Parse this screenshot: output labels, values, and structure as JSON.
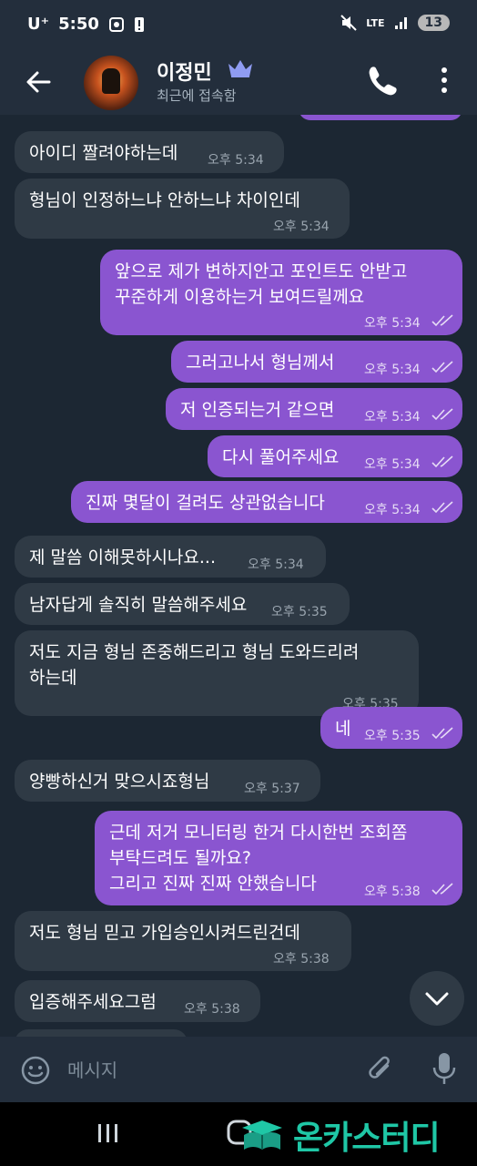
{
  "status_bar": {
    "carrier": "U⁺",
    "time": "5:50",
    "network": "LTE",
    "battery": "13"
  },
  "header": {
    "name": "이정민",
    "status": "최근에 접속함"
  },
  "messages": [
    {
      "dir": "in",
      "text": "아이디 짤려야하는데",
      "time": "오후 5:34"
    },
    {
      "dir": "in",
      "text": "형님이 인정하느냐 안하느냐 차이인데",
      "time": "오후 5:34"
    },
    {
      "dir": "out",
      "lines": [
        "앞으로 제가 변하지안고 포인트도 안받고",
        "꾸준하게 이용하는거 보여드릴께요"
      ],
      "time": "오후 5:34"
    },
    {
      "dir": "out",
      "text": "그러고나서 형님께서",
      "time": "오후 5:34"
    },
    {
      "dir": "out",
      "text": "저 인증되는거 같으면",
      "time": "오후 5:34"
    },
    {
      "dir": "out",
      "text": "다시 풀어주세요",
      "time": "오후 5:34"
    },
    {
      "dir": "out",
      "text": "진짜 몇달이 걸려도 상관없습니다",
      "time": "오후 5:34"
    },
    {
      "dir": "in",
      "text": "제 말씀 이해못하시나요...",
      "time": "오후 5:34"
    },
    {
      "dir": "in",
      "text": "남자답게 솔직히 말씀해주세요",
      "time": "오후 5:35"
    },
    {
      "dir": "in",
      "lines": [
        "저도 지금 형님 존중해드리고 형님 도와드리려",
        "하는데"
      ],
      "time": "오후 5:35"
    },
    {
      "dir": "out",
      "text": "네",
      "time": "오후 5:35"
    },
    {
      "dir": "in",
      "text": "양빵하신거 맞으시죠형님",
      "time": "오후 5:37"
    },
    {
      "dir": "out",
      "lines": [
        "근데 저거 모니터링 한거 다시한번 조회쫌",
        "부탁드려도 될까요?",
        "그리고 진짜 진짜 안했습니다"
      ],
      "time": "오후 5:38"
    },
    {
      "dir": "in",
      "text": "저도 형님 믿고 가입승인시켜드린건데",
      "time": "오후 5:38"
    },
    {
      "dir": "in",
      "text": "입증해주세요그럼",
      "time": "오후 5:38"
    }
  ],
  "input": {
    "placeholder": "메시지"
  },
  "watermark": "온카스터디",
  "colors": {
    "background": "#1c2733",
    "bar": "#232e3c",
    "incoming_bubble": "#2f3a45",
    "outgoing_bubble": "#8a55d0",
    "crown": "#8f9cf2",
    "watermark": "#1fc7a6"
  }
}
